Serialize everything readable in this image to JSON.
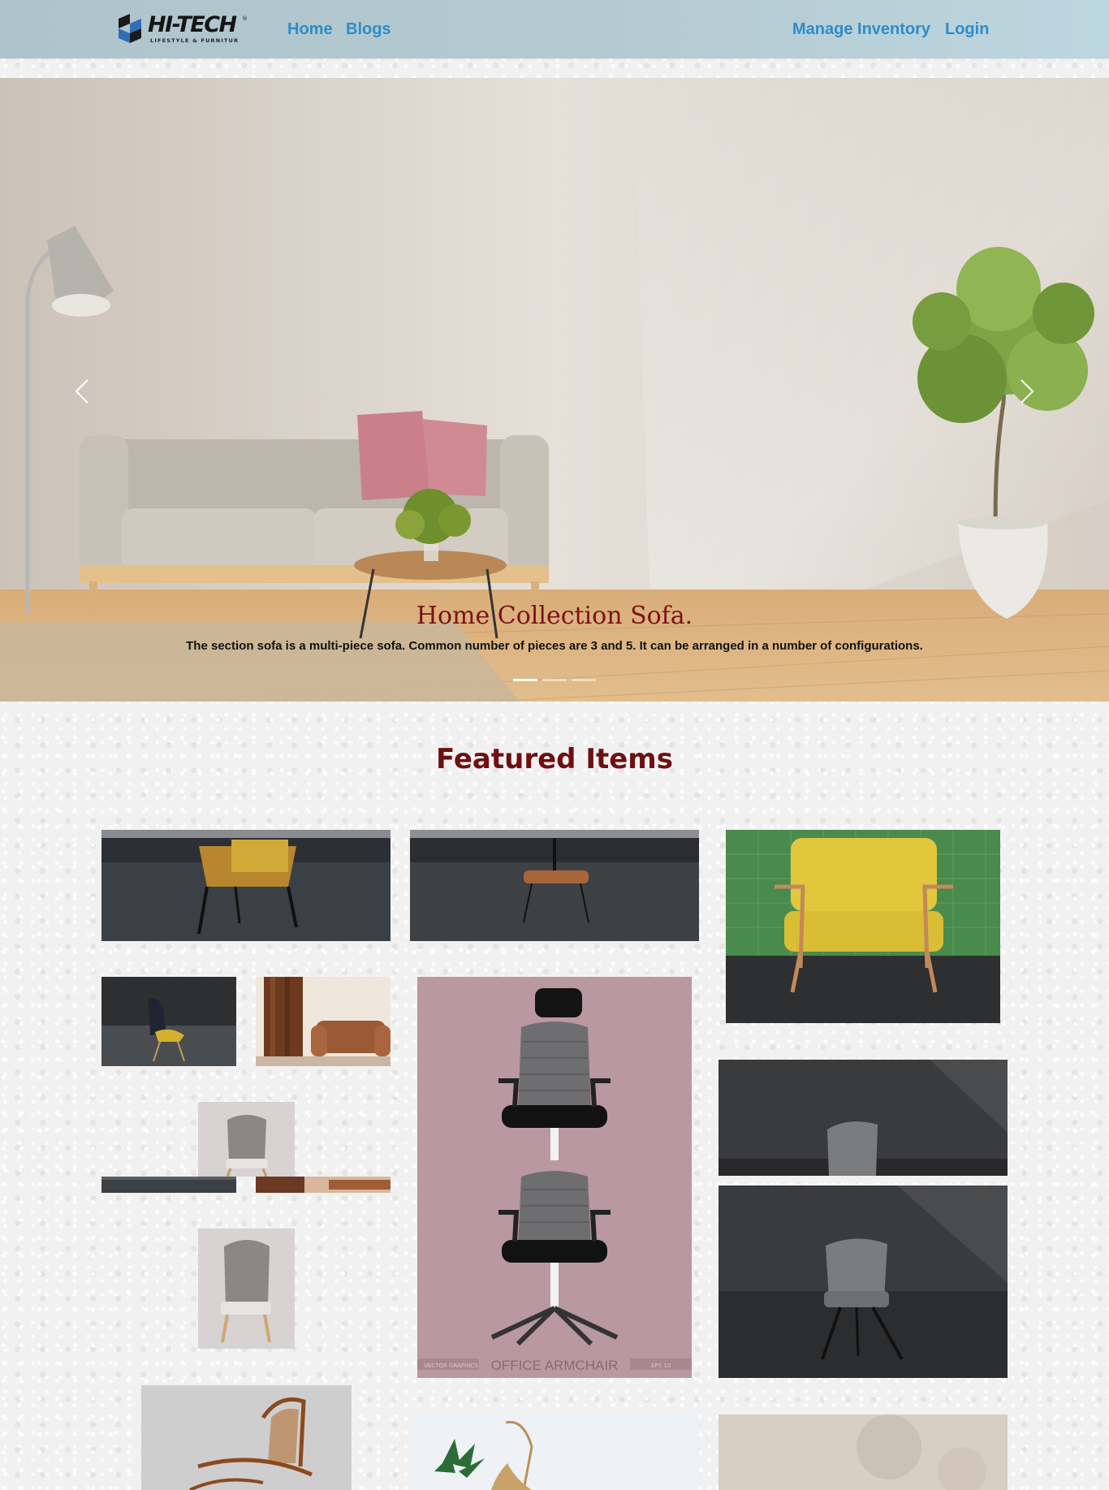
{
  "nav": {
    "brand": {
      "name": "HI-TECH",
      "tagline": "LIFESTYLE & FURNITUR",
      "reg": "®"
    },
    "links": [
      "Home",
      "Blogs",
      "Manage Inventory",
      "Login"
    ]
  },
  "hero": {
    "caption_title": "Home Collection Sofa.",
    "caption_text": "The section sofa is a multi-piece sofa. Common number of pieces are 3 and 5. It can be arranged in a number of configurations.",
    "prev_icon": "chevron-left-icon",
    "next_icon": "chevron-right-icon",
    "slide_count": 3,
    "active_slide": 1
  },
  "featured": {
    "title": "Featured Items",
    "office_chair_label": "OFFICE ARMCHAIR",
    "office_chair_tag_left": "VECTOR GRAPHICS",
    "office_chair_tag_right": "EPS 10"
  },
  "colors": {
    "nav_link": "#2d8dc9",
    "caption_title": "#7b1216",
    "section_title": "#6e0f12"
  }
}
